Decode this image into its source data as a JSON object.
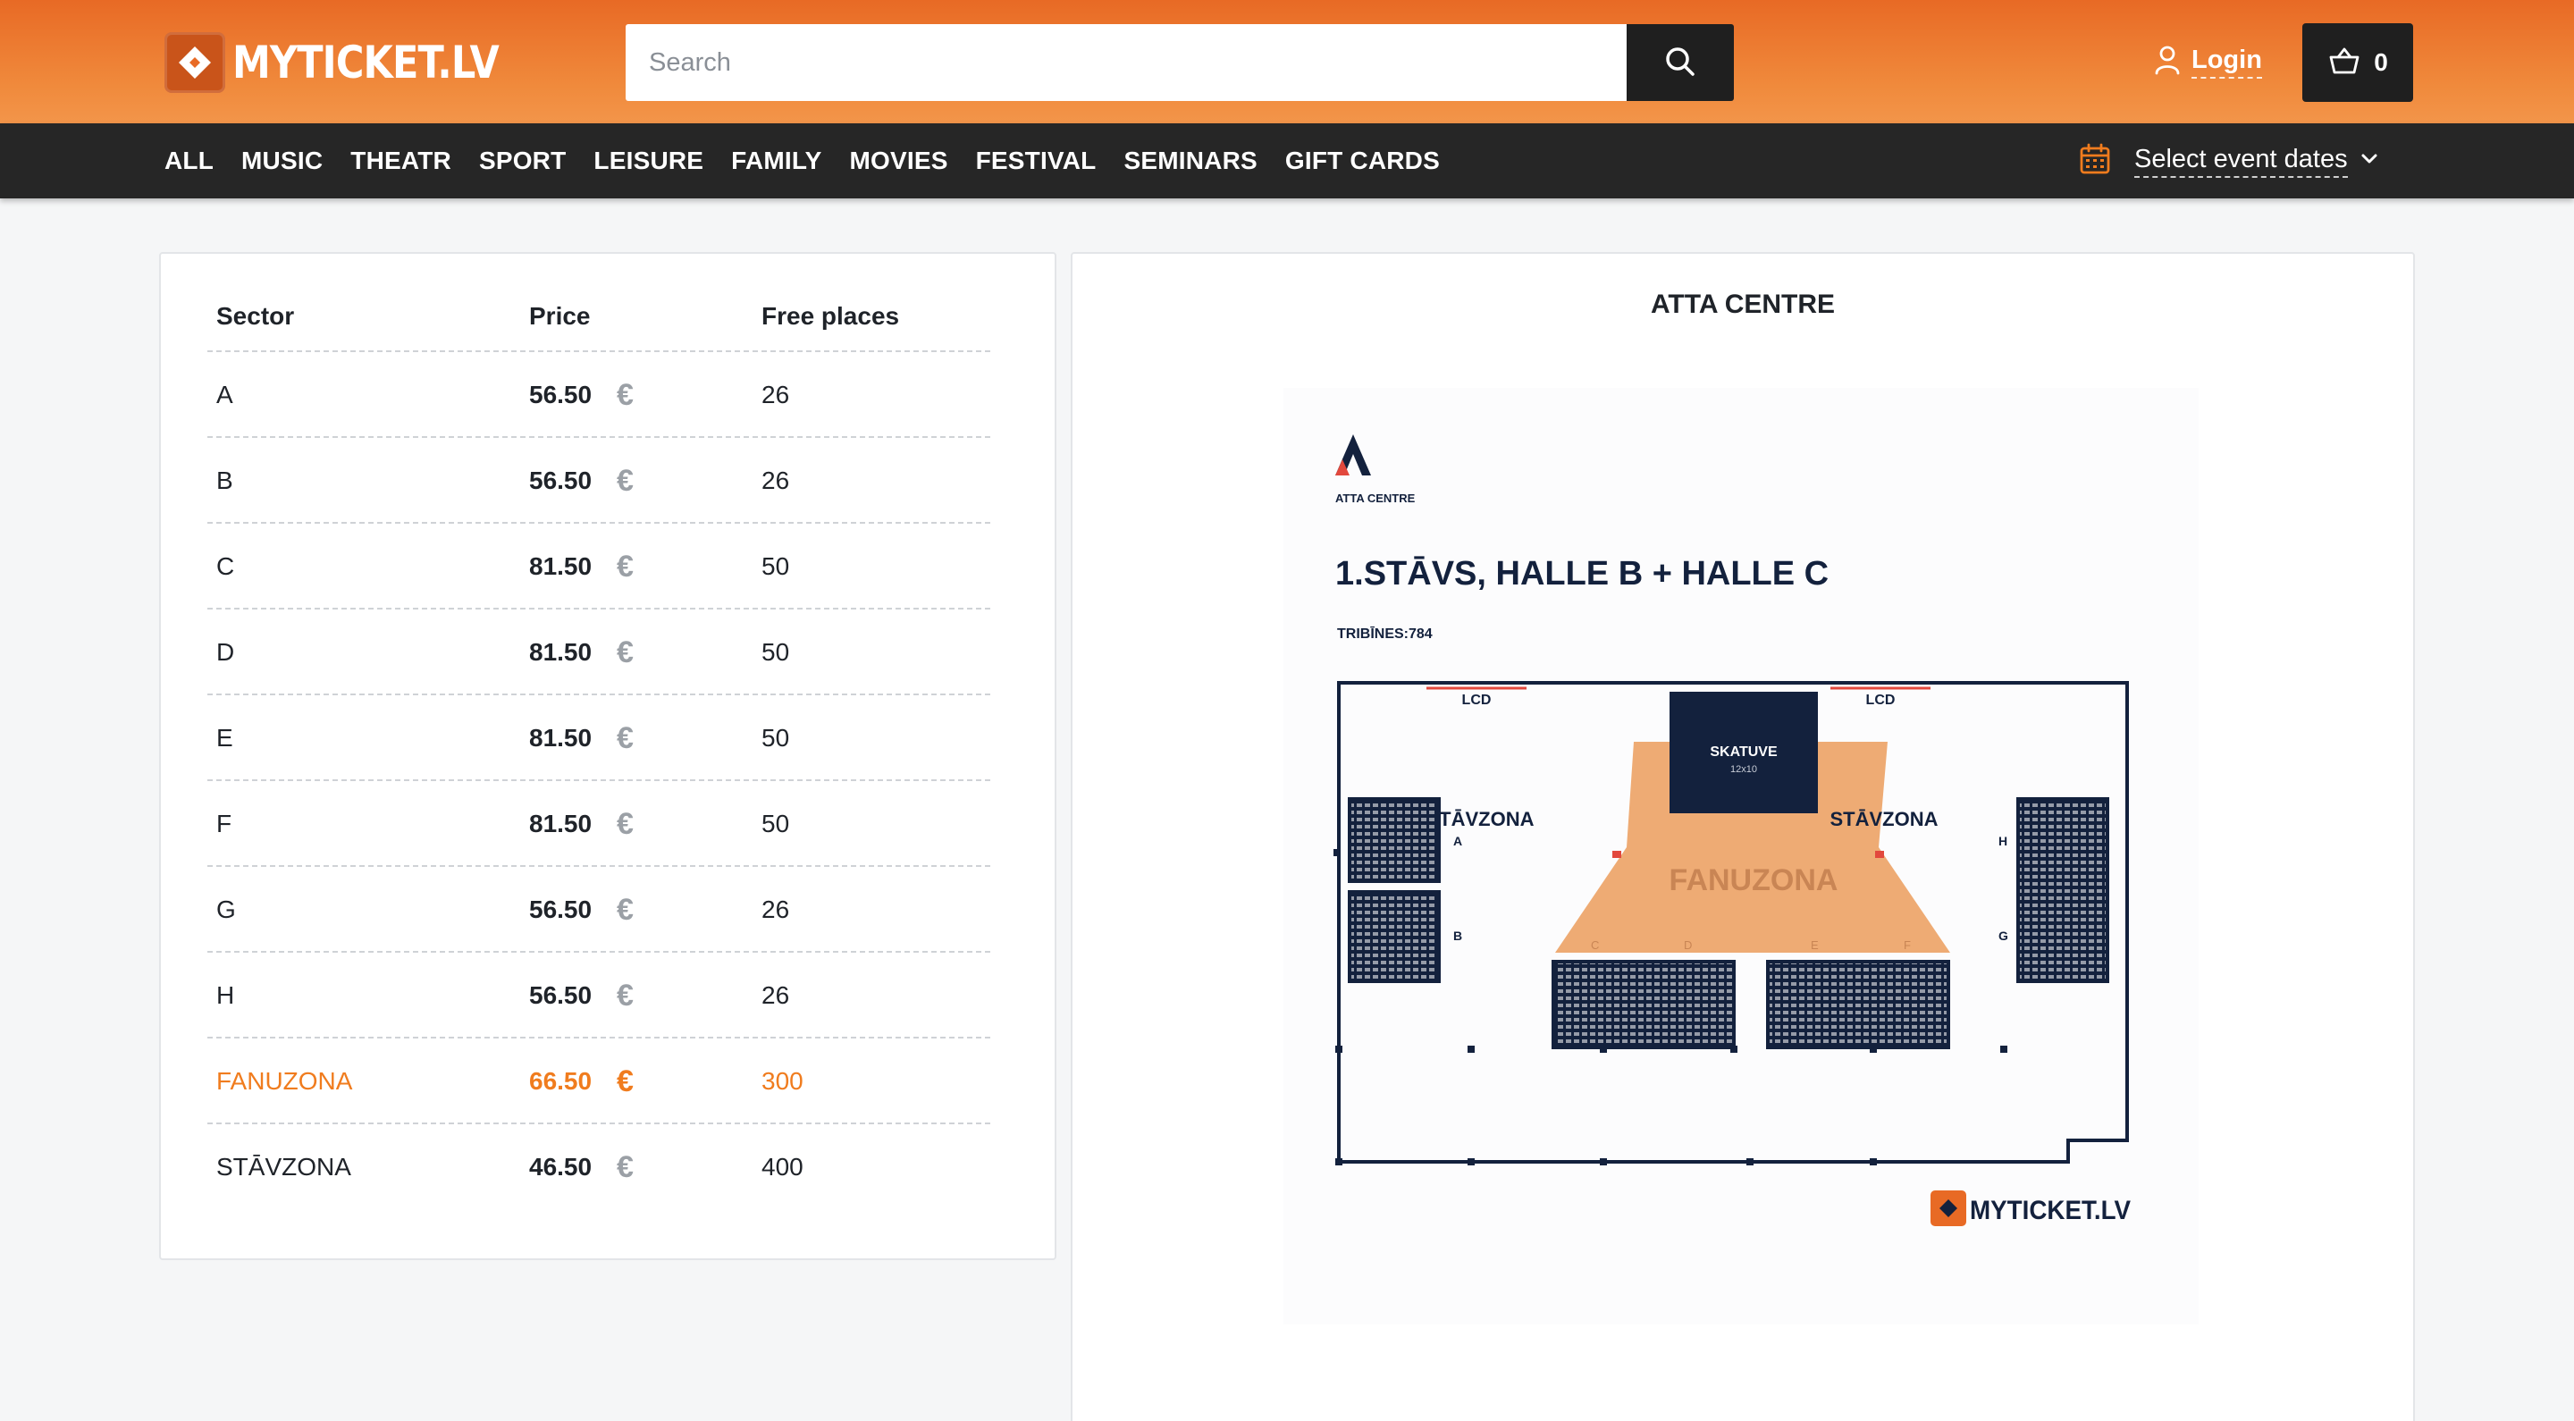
{
  "header": {
    "logo_text": "MYTICKET.LV",
    "search_placeholder": "Search",
    "login_label": "Login",
    "cart_count": "0"
  },
  "nav": {
    "items": [
      "ALL",
      "MUSIC",
      "THEATR",
      "SPORT",
      "LEISURE",
      "FAMILY",
      "MOVIES",
      "FESTIVAL",
      "SEMINARS",
      "GIFT CARDS"
    ],
    "dates_label": "Select event dates"
  },
  "table": {
    "headers": {
      "sector": "Sector",
      "price": "Price",
      "free": "Free places"
    },
    "currency": "€",
    "rows": [
      {
        "sector": "A",
        "price": "56.50",
        "free": "26"
      },
      {
        "sector": "B",
        "price": "56.50",
        "free": "26"
      },
      {
        "sector": "C",
        "price": "81.50",
        "free": "50"
      },
      {
        "sector": "D",
        "price": "81.50",
        "free": "50"
      },
      {
        "sector": "E",
        "price": "81.50",
        "free": "50"
      },
      {
        "sector": "F",
        "price": "81.50",
        "free": "50"
      },
      {
        "sector": "G",
        "price": "56.50",
        "free": "26"
      },
      {
        "sector": "H",
        "price": "56.50",
        "free": "26"
      },
      {
        "sector": "FANUZONA",
        "price": "66.50",
        "free": "300",
        "highlighted": true
      },
      {
        "sector": "STĀVZONA",
        "price": "46.50",
        "free": "400"
      }
    ]
  },
  "venue": {
    "title": "ATTA CENTRE",
    "map": {
      "brand": "ATTA CENTRE",
      "floor_title": "1.STĀVS, HALLE B + HALLE C",
      "tribunes": "TRIBĪNES:784",
      "lcd_label": "LCD",
      "stage_label": "SKATUVE",
      "stage_size": "12x10",
      "standing_label": "STĀVZONA",
      "fan_label": "FANUZONA",
      "sector_letters": [
        "A",
        "B",
        "C",
        "D",
        "E",
        "F",
        "G",
        "H"
      ],
      "footer_logo": "MYTICKET.LV"
    }
  },
  "colors": {
    "brand_orange": "#f07c1e",
    "header_gradient_top": "#e86a25",
    "nav_bg": "#262626",
    "fan_zone": "#eeab74",
    "seat_navy": "#13213d"
  }
}
